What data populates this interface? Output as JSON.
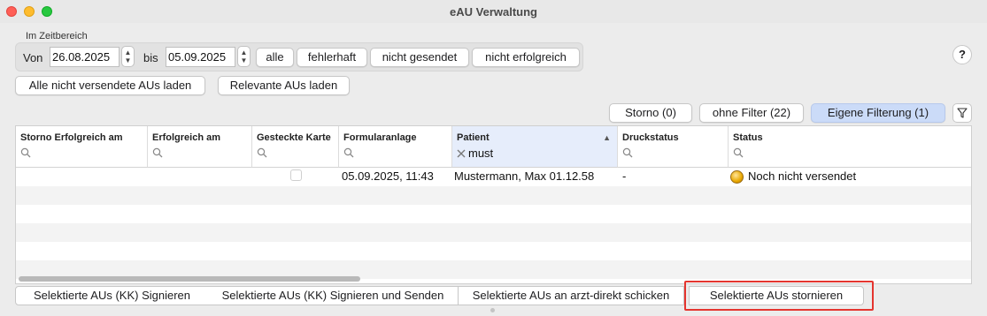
{
  "window": {
    "title": "eAU Verwaltung"
  },
  "timerange": {
    "group_label": "Im Zeitbereich",
    "from_label": "Von",
    "from_value": "26.08.2025",
    "to_label": "bis",
    "to_value": "05.09.2025",
    "quick_buttons": [
      "alle",
      "fehlerhaft",
      "nicht gesendet",
      "nicht erfolgreich"
    ]
  },
  "load_buttons": {
    "all_unsent": "Alle nicht versendete AUs laden",
    "relevant": "Relevante AUs laden"
  },
  "help_label": "?",
  "filters": {
    "storno": "Storno (0)",
    "no_filter": "ohne Filter (22)",
    "own_filter": "Eigene Filterung (1)",
    "active": "own_filter"
  },
  "table": {
    "columns": [
      {
        "title": "Storno Erfolgreich am",
        "filter": ""
      },
      {
        "title": "Erfolgreich am",
        "filter": ""
      },
      {
        "title": "Gesteckte Karte",
        "filter": ""
      },
      {
        "title": "Formularanlage",
        "filter": ""
      },
      {
        "title": "Patient",
        "filter": "must",
        "sorted": "ascending"
      },
      {
        "title": "Druckstatus",
        "filter": ""
      },
      {
        "title": "Status",
        "filter": ""
      }
    ],
    "rows": [
      {
        "storno": "",
        "erfolgreich": "",
        "karte_checked": false,
        "formularanlage": "05.09.2025, 11:43",
        "patient": "Mustermann, Max 01.12.58",
        "druckstatus": "-",
        "status": "Noch nicht versendet",
        "status_color": "#e9a800"
      }
    ]
  },
  "actions": {
    "sign": "Selektierte AUs (KK) Signieren",
    "sign_send": "Selektierte AUs (KK) Signieren und Senden",
    "arzt_direkt": "Selektierte AUs an arzt-direkt schicken",
    "storno": "Selektierte AUs stornieren"
  },
  "colors": {
    "accent_selected": "#cbdbf8",
    "highlight_border": "#e4352f"
  }
}
